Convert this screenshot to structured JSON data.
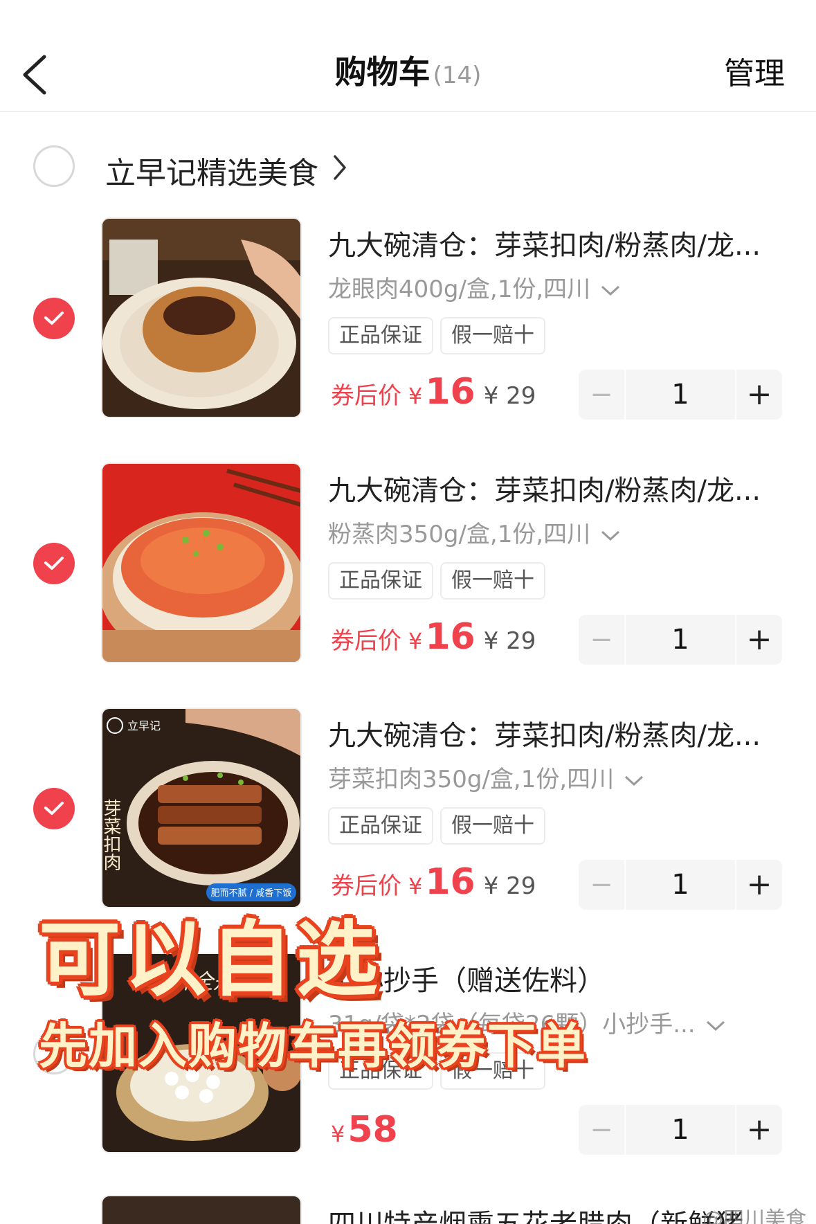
{
  "header": {
    "title": "购物车",
    "count": "(14)",
    "manage": "管理"
  },
  "shop": {
    "name": "立早记精选美食"
  },
  "items": [
    {
      "name": "九大碗清仓：芽菜扣肉/粉蒸肉/龙...",
      "spec": "龙眼肉400g/盒,1份,四川",
      "tags": [
        "正品保证",
        "假一赔十"
      ],
      "price_label": "券后价",
      "currency": "¥",
      "price": "16",
      "original": "¥ 29",
      "qty": "1",
      "checked": true
    },
    {
      "name": "九大碗清仓：芽菜扣肉/粉蒸肉/龙...",
      "spec": "粉蒸肉350g/盒,1份,四川",
      "tags": [
        "正品保证",
        "假一赔十"
      ],
      "price_label": "券后价",
      "currency": "¥",
      "price": "16",
      "original": "¥ 29",
      "qty": "1",
      "checked": true
    },
    {
      "name": "九大碗清仓：芽菜扣肉/粉蒸肉/龙...",
      "spec": "芽菜扣肉350g/盒,1份,四川",
      "tags": [
        "正品保证",
        "假一赔十"
      ],
      "price_label": "券后价",
      "currency": "¥",
      "price": "16",
      "original": "¥ 29",
      "qty": "1",
      "checked": true,
      "thumb_text": {
        "brand": "立早记",
        "vertical": "芽菜扣肉",
        "badge": "肥而不腻 / 咸香下饭"
      }
    },
    {
      "name": "工小抄手（赠送佐料）",
      "spec": "31g/袋*2袋（每袋26颗）小抄手...",
      "tags": [
        "正品保证",
        "假一赔十"
      ],
      "currency": "¥",
      "price": "58",
      "qty": "1",
      "checked": false,
      "thumb_text": {
        "promo": "咬开全是料"
      }
    }
  ],
  "stepper": {
    "minus": "−",
    "plus": "+"
  },
  "next_item": {
    "name": "四川特产烟熏五花老腊肉（新鲜猪"
  },
  "overlay": {
    "line1": "可以自选",
    "line2": "先加入购物车再领券下单"
  },
  "watermark": "@四川美食",
  "colors": {
    "accent": "#f0424c",
    "overlay_text": "#fff2c8",
    "overlay_stroke": "#e8421e"
  }
}
